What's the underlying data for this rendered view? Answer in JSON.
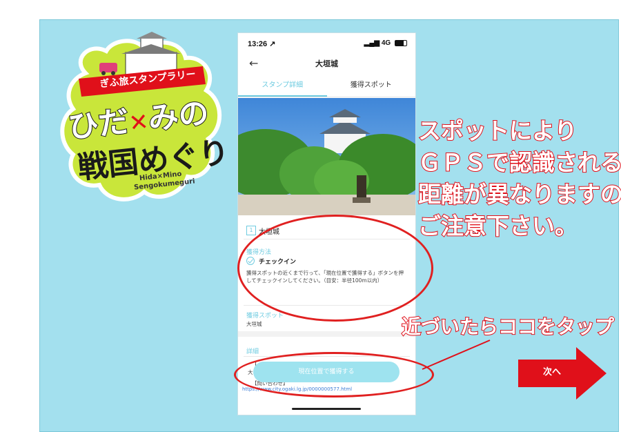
{
  "logo": {
    "ribbon": "ぎふ旅スタンプラリー",
    "line1_a": "ひだ",
    "line1_b": "みの",
    "line2": "戦国めぐり",
    "romaji1": "Hida×Mino",
    "romaji2": "Sengokumeguri"
  },
  "status_bar": {
    "time": "13:26 ↗",
    "signal": "4G"
  },
  "header": {
    "back_icon": "arrow-left-icon",
    "title": "大垣城"
  },
  "tabs": [
    {
      "label": "スタンプ詳細",
      "active": true
    },
    {
      "label": "獲得スポット",
      "active": false
    }
  ],
  "spot": {
    "number": "1",
    "name": "大垣城"
  },
  "acquire": {
    "heading": "獲得方法",
    "method": "チェックイン",
    "description": "獲得スポットの近くまで行って、「現在位置で獲得する」ボタンを押してチェックインしてください。（目安：半径100m以内）"
  },
  "acquire_spot": {
    "heading": "獲得スポット",
    "value": "大垣城"
  },
  "details": {
    "heading": "詳細",
    "line1": "【",
    "line2": "大",
    "line3": "【問い合わせ】",
    "url": "https://www.city.ogaki.lg.jp/0000000577.html"
  },
  "action_button": "現在位置で獲得する",
  "callouts": {
    "warning": [
      "スポットにより",
      "ＧＰＳで認識される",
      "距離が異なりますので",
      "ご注意下さい。"
    ],
    "tap_here": "近づいたらココをタップ",
    "next": "次へ"
  },
  "colors": {
    "accent": "#6ecbe0",
    "warning_red": "#e0101a",
    "slide_bg": "#a3e0ee",
    "logo_green": "#c9e63a"
  }
}
